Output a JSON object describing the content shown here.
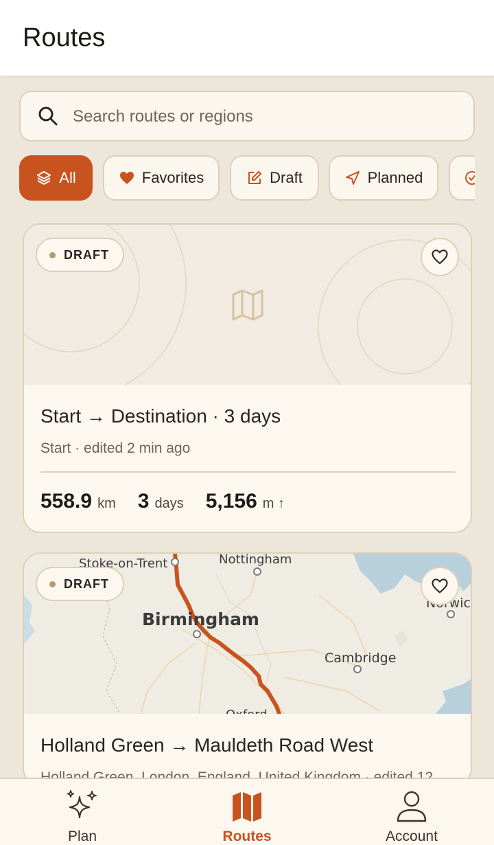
{
  "header": {
    "title": "Routes"
  },
  "search": {
    "placeholder": "Search routes or regions"
  },
  "filters": [
    {
      "label": "All",
      "icon": "layers-icon",
      "active": true
    },
    {
      "label": "Favorites",
      "icon": "heart-icon",
      "active": false
    },
    {
      "label": "Draft",
      "icon": "edit-icon",
      "active": false
    },
    {
      "label": "Planned",
      "icon": "navigate-icon",
      "active": false
    },
    {
      "label": "",
      "icon": "check-circle-icon",
      "active": false
    }
  ],
  "routes": [
    {
      "status": "DRAFT",
      "title": "Start → Destination · 3 days",
      "subtitle": "Start · edited 2 min ago",
      "distance_value": "558.9",
      "distance_unit": "km",
      "days_value": "3",
      "days_unit": "days",
      "elevation_value": "5,156",
      "elevation_unit": "m ↑",
      "thumbnail": "map-placeholder-icon"
    },
    {
      "status": "DRAFT",
      "title": "Holland Green → Mauldeth Road West",
      "subtitle": "Holland Green, London, England, United Kingdom · edited 12",
      "map_labels": {
        "stoke": "Stoke-on-Trent",
        "nottingham": "Nottingham",
        "birmingham": "Birmingham",
        "cambridge": "Cambridge",
        "norwich": "Norwich",
        "oxford": "Oxford"
      }
    }
  ],
  "bottom_nav": [
    {
      "label": "Plan",
      "icon": "sparkles-icon",
      "active": false
    },
    {
      "label": "Routes",
      "icon": "map-icon",
      "active": true
    },
    {
      "label": "Account",
      "icon": "user-icon",
      "active": false
    }
  ],
  "colors": {
    "accent": "#c9531f",
    "background": "#ede6da",
    "card": "#fcf8ef",
    "border": "#ddd0b9",
    "route_line": "#c9531f"
  }
}
